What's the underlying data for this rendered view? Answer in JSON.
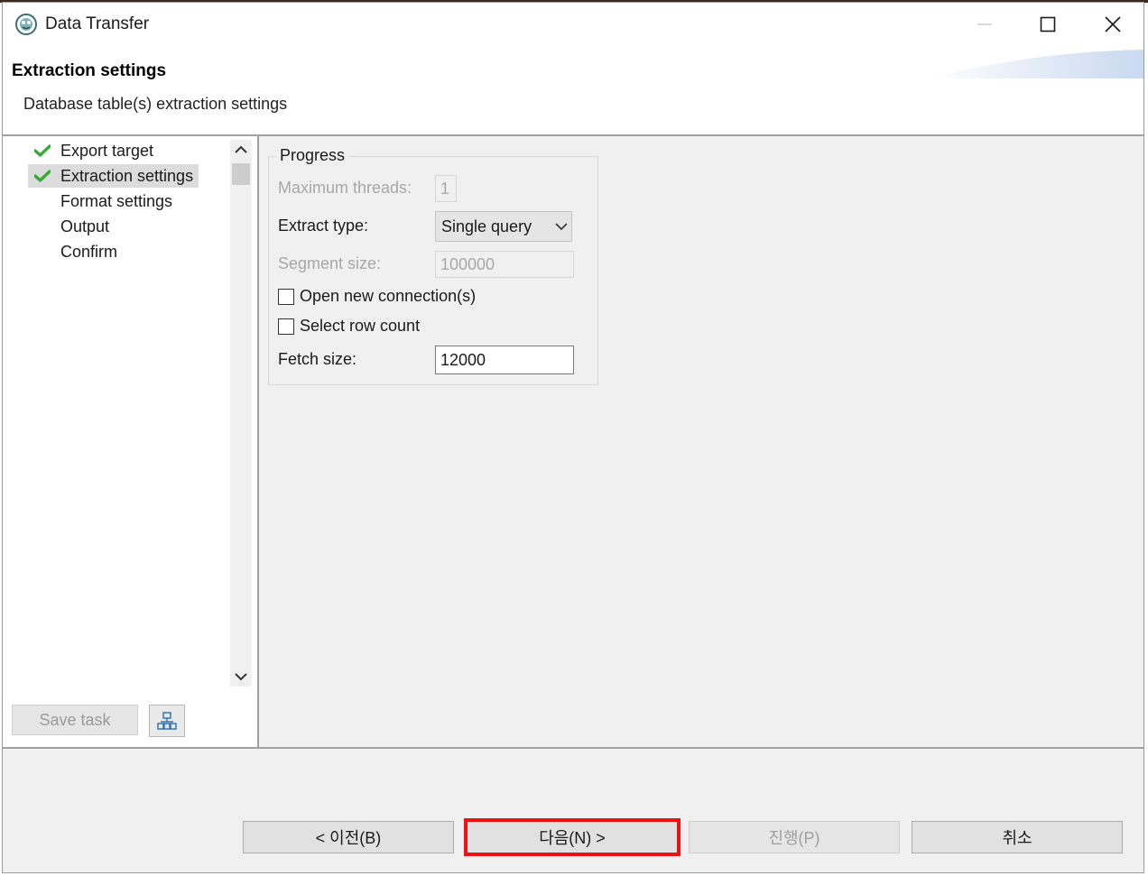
{
  "window": {
    "title": "Data Transfer",
    "controls": {
      "minimize": "minimize-icon",
      "maximize": "maximize-icon",
      "close": "close-icon"
    }
  },
  "header": {
    "title": "Extraction settings",
    "subtitle": "Database table(s) extraction settings"
  },
  "nav": {
    "items": [
      {
        "label": "Export target",
        "done": true,
        "selected": false
      },
      {
        "label": "Extraction settings",
        "done": true,
        "selected": true
      },
      {
        "label": "Format settings",
        "done": false,
        "selected": false
      },
      {
        "label": "Output",
        "done": false,
        "selected": false
      },
      {
        "label": "Confirm",
        "done": false,
        "selected": false
      }
    ],
    "save_task_label": "Save task",
    "save_task_enabled": false,
    "tool_icon": "hierarchy-icon"
  },
  "progress": {
    "group_label": "Progress",
    "max_threads_label": "Maximum threads:",
    "max_threads_value": "1",
    "extract_type_label": "Extract type:",
    "extract_type_value": "Single query",
    "segment_size_label": "Segment size:",
    "segment_size_value": "100000",
    "open_new_connection_label": "Open new connection(s)",
    "open_new_connection_checked": false,
    "select_row_count_label": "Select row count",
    "select_row_count_checked": false,
    "fetch_size_label": "Fetch size:",
    "fetch_size_value": "12000"
  },
  "footer": {
    "back_label": "< 이전(B)",
    "next_label": "다음(N) >",
    "proceed_label": "진행(P)",
    "cancel_label": "취소"
  },
  "colors": {
    "check": "#3aa83a",
    "highlight": "#ee1111",
    "window_bg": "#f0f0f0"
  }
}
